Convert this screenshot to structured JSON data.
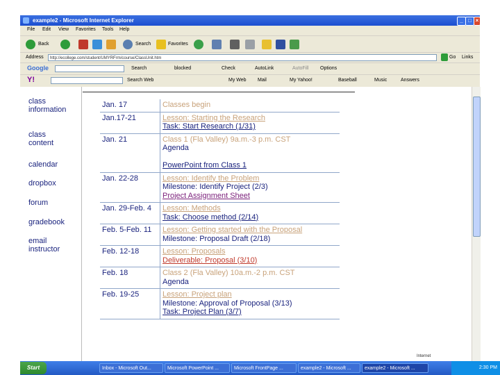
{
  "window": {
    "title": "example2 - Microsoft Internet Explorer"
  },
  "menu": [
    "File",
    "Edit",
    "View",
    "Favorites",
    "Tools",
    "Help"
  ],
  "toolbar": {
    "back": "Back",
    "search": "Search",
    "favorites": "Favorites"
  },
  "address": {
    "label": "Address",
    "url": "http://ecollege.com/student/UMYRFrm/course/ClassUnit.htm",
    "go": "Go",
    "links": "Links"
  },
  "google_bar": {
    "logo": "Google",
    "search": "Search",
    "blocked": "blocked",
    "check": "Check",
    "autolink": "AutoLink",
    "autofill": "AutoFill",
    "options": "Options"
  },
  "yahoo_bar": {
    "logo": "Y!",
    "search_web": "Search Web",
    "my_web": "My Web",
    "mail": "Mail",
    "my_yahoo": "My Yahoo!",
    "baseball": "Baseball",
    "music": "Music",
    "answers": "Answers"
  },
  "nav": [
    "class information",
    "class content",
    "calendar",
    "dropbox",
    "forum",
    "gradebook",
    "email instructor"
  ],
  "schedule": [
    {
      "date": "Jan. 17",
      "lines": [
        {
          "text": "Classes begin",
          "style": "beige"
        }
      ]
    },
    {
      "date": "Jan.17-21",
      "lines": [
        {
          "text": "Lesson: Starting the Research",
          "style": "beige-ul"
        },
        {
          "text": "Task: Start Research (1/31)",
          "style": "navy-ul"
        }
      ]
    },
    {
      "date": "Jan. 21",
      "lines": [
        {
          "text": "Class 1 (Fla Valley) 9a.m.-3 p.m. CST",
          "style": "beige"
        },
        {
          "text": "Agenda",
          "style": "navy"
        },
        {
          "text": "",
          "style": "navy"
        },
        {
          "text": "PowerPoint from Class 1",
          "style": "navy-ul"
        }
      ]
    },
    {
      "date": "Jan. 22-28",
      "lines": [
        {
          "text": "Lesson: Identify the Problem",
          "style": "beige-ul"
        },
        {
          "text": "Milestone: Identify Project (2/3)",
          "style": "navy"
        },
        {
          "text": "Project Assignment Sheet",
          "style": "purple-ul"
        }
      ]
    },
    {
      "date": "Jan. 29-Feb. 4",
      "lines": [
        {
          "text": "Lesson: Methods",
          "style": "beige-ul"
        },
        {
          "text": "Task: Choose method (2/14)",
          "style": "navy-ul"
        }
      ]
    },
    {
      "date": "Feb. 5-Feb. 11",
      "lines": [
        {
          "text": "Lesson: Getting started with the Proposal",
          "style": "beige-ul"
        },
        {
          "text": "Milestone: Proposal Draft (2/18)",
          "style": "navy"
        }
      ]
    },
    {
      "date": "Feb. 12-18",
      "lines": [
        {
          "text": "Lesson: Proposals",
          "style": "beige-ul"
        },
        {
          "text": "Deliverable: Proposal (3/10)",
          "style": "red-ul"
        }
      ]
    },
    {
      "date": "Feb. 18",
      "lines": [
        {
          "text": "Class 2 (Fla Valley) 10a.m.-2 p.m. CST",
          "style": "beige"
        },
        {
          "text": "Agenda",
          "style": "navy"
        }
      ]
    },
    {
      "date": "Feb. 19-25",
      "lines": [
        {
          "text": "Lesson: Project plan",
          "style": "beige-ul"
        },
        {
          "text": "Milestone: Approval of Proposal (3/13)",
          "style": "navy"
        },
        {
          "text": "Task: Project Plan (3/7)",
          "style": "navy-ul"
        }
      ]
    }
  ],
  "status": {
    "zone": "Internet"
  },
  "taskbar": {
    "start": "Start",
    "items": [
      "Inbox - Microsoft Out...",
      "Microsoft PowerPoint ...",
      "Microsoft FrontPage ...",
      "example2 - Microsoft ...",
      "example2 - Microsoft ..."
    ],
    "clock": "2:30 PM"
  },
  "colors": {
    "navy": "#1a237e",
    "beige": "#c8a27a",
    "red": "#c0392b",
    "purple": "#7a1f7a",
    "xp_blue": "#2359c4"
  }
}
